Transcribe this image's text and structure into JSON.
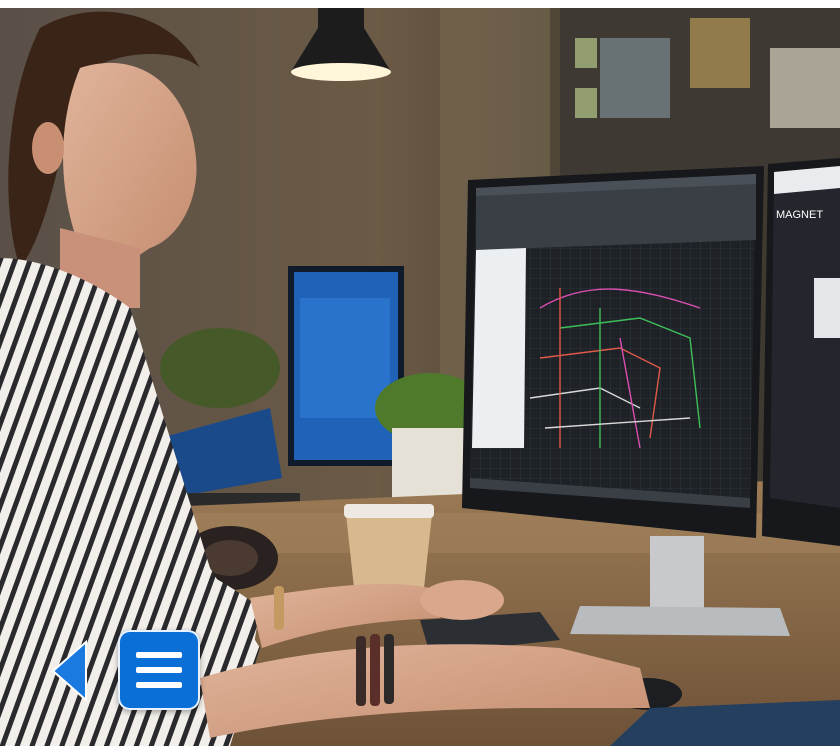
{
  "photo": {
    "subject": "woman-at-cad-workstation",
    "colors": {
      "wall": "#4a4036",
      "desk": "#8a6a48",
      "monitor_bezel": "#1b1d20",
      "cad_background": "#1e2126",
      "screen_blue": "#1e6fd0"
    }
  },
  "screen_text": {
    "brand": "MAGNET"
  },
  "nav": {
    "back_icon": "triangle-left-icon",
    "menu_icon": "hamburger-menu-icon",
    "accent": "#0b6fd8",
    "back_color": "#1a7ae0"
  }
}
